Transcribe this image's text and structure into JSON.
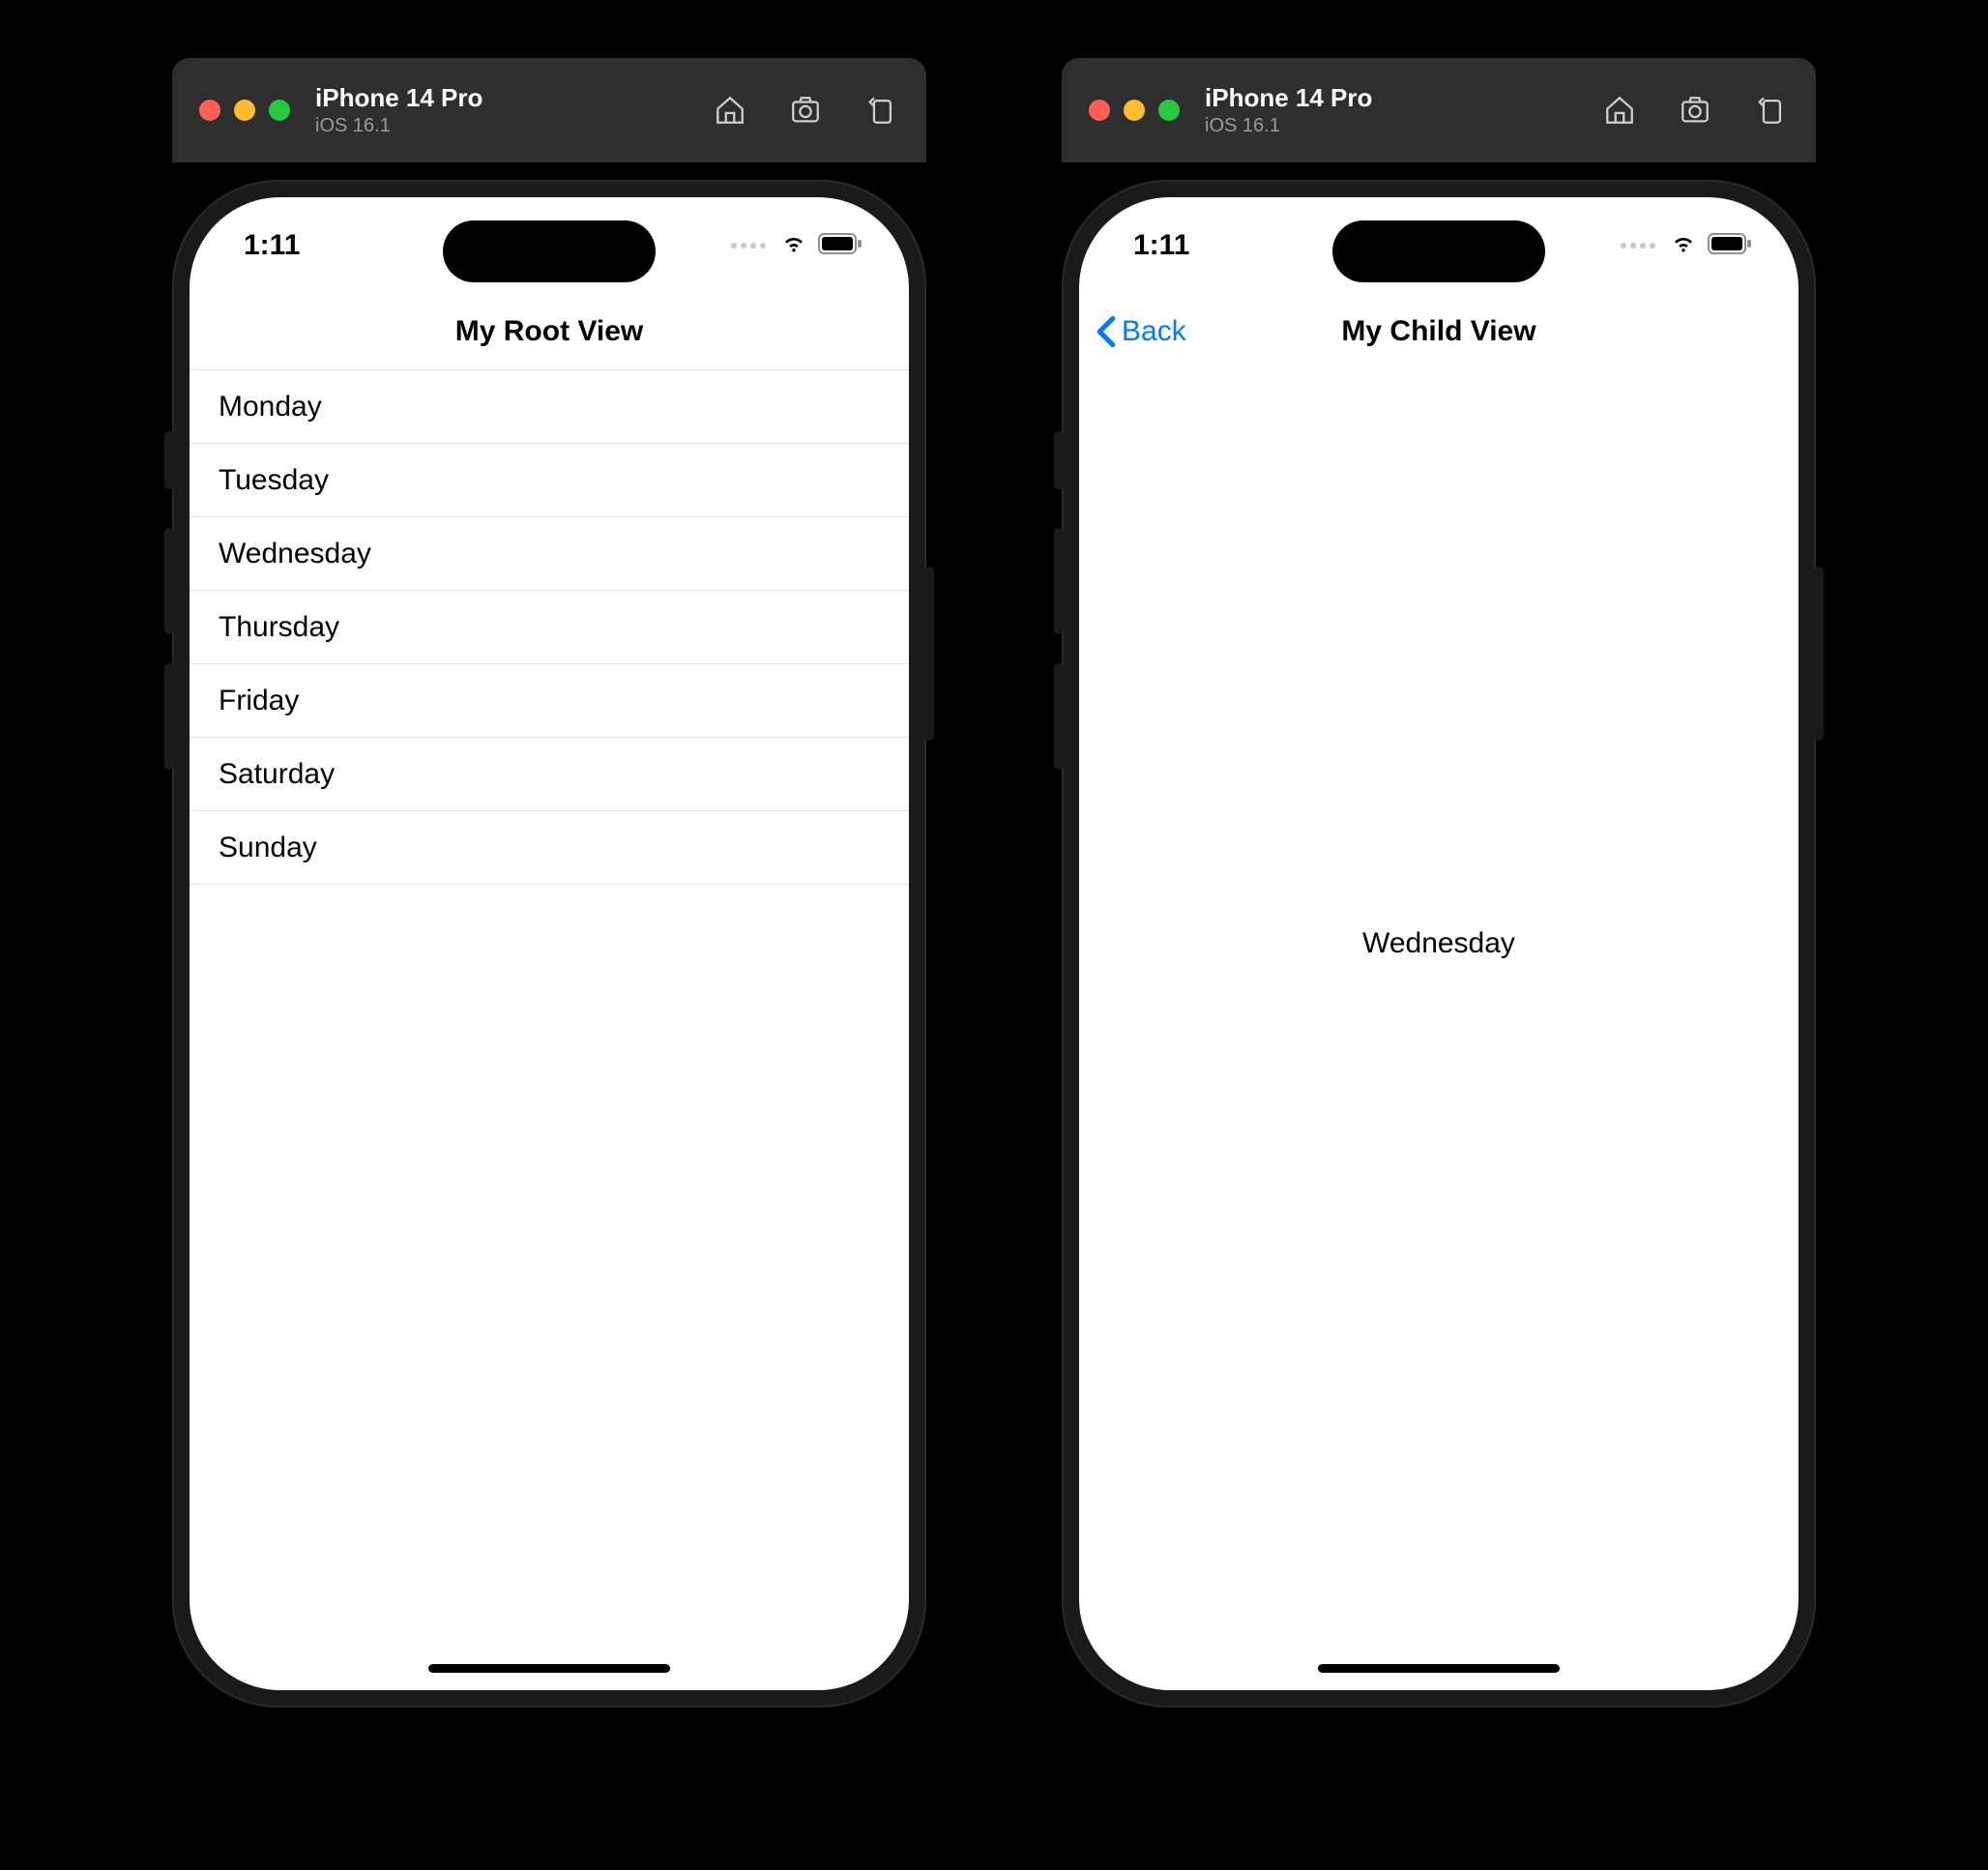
{
  "simulators": [
    {
      "toolbar": {
        "device": "iPhone 14 Pro",
        "os": "iOS 16.1"
      },
      "status": {
        "time": "1:11"
      },
      "nav": {
        "title": "My Root View"
      },
      "list": {
        "items": [
          "Monday",
          "Tuesday",
          "Wednesday",
          "Thursday",
          "Friday",
          "Saturday",
          "Sunday"
        ]
      }
    },
    {
      "toolbar": {
        "device": "iPhone 14 Pro",
        "os": "iOS 16.1"
      },
      "status": {
        "time": "1:11"
      },
      "nav": {
        "title": "My Child View",
        "back": "Back"
      },
      "content": {
        "text": "Wednesday"
      }
    }
  ]
}
